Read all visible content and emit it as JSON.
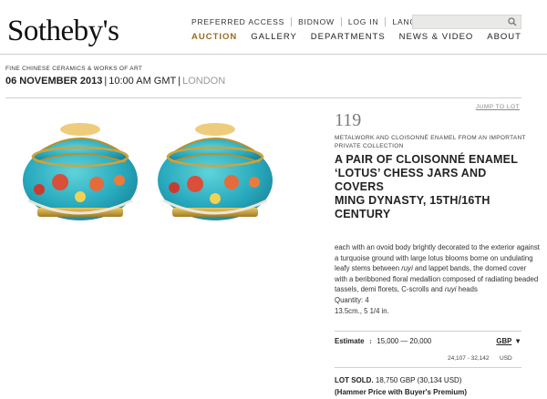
{
  "brand": {
    "logo": "Sotheby's"
  },
  "topnav": [
    "PREFERRED ACCESS",
    "BIDNOW",
    "LOG IN",
    "LANGUAGES"
  ],
  "mainnav": [
    {
      "label": "AUCTION",
      "active": true
    },
    {
      "label": "GALLERY"
    },
    {
      "label": "DEPARTMENTS"
    },
    {
      "label": "NEWS & VIDEO"
    },
    {
      "label": "ABOUT"
    }
  ],
  "sale": {
    "department": "FINE CHINESE CERAMICS & WORKS OF ART",
    "date": "06 NOVEMBER 2013",
    "time": "10:00 AM GMT",
    "location": "LONDON"
  },
  "jump_to_lot": "JUMP TO LOT",
  "lot": {
    "number": "119",
    "subtitle": "METALWORK AND CLOISONNÉ ENAMEL FROM AN IMPORTANT PRIVATE COLLECTION",
    "title_lines": [
      "A PAIR OF CLOISONNÉ ENAMEL",
      "‘LOTUS’ CHESS JARS AND",
      "COVERS",
      "MING DYNASTY, 15TH/16TH",
      "CENTURY"
    ],
    "description": {
      "part1": "each with an ovoid body brightly decorated to the exterior against a turquoise ground with large lotus blooms borne on undulating leafy stems between ",
      "ruyi1": "ruyi",
      "part2": " and lappet bands, the domed cover with a beribboned floral medallion composed of radiating beaded tassels, demi florets, C-scrolls and ",
      "ruyi2": "ruyi",
      "part3": " heads",
      "quantity": "Quantity: 4",
      "dimensions": "13.5cm., 5 1/4 in."
    },
    "estimate": {
      "label": "Estimate",
      "arrows": "↕",
      "low": "15,000",
      "dash": "—",
      "high": "20,000",
      "currency": "GBP",
      "currency_arrow": "▼",
      "converted": "24,107 - 32,142",
      "converted_currency": "USD"
    },
    "result": {
      "label": "LOT SOLD.",
      "amount": "18,750 GBP (30,134 USD)",
      "note": "(Hammer Price with Buyer's Premium)"
    }
  },
  "colors": {
    "accent": "#9a6b1f",
    "turquoise": "#2fb6c6",
    "gold": "#c9a33a"
  }
}
